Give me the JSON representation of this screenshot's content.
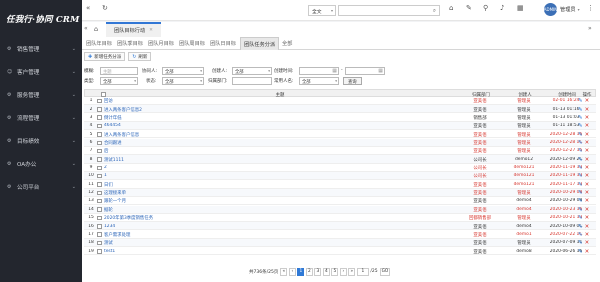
{
  "brand": {
    "logo_text": "任我行·协同 CRM"
  },
  "sidebar": {
    "items": [
      {
        "label": "销售管理",
        "icon": "gear-icon"
      },
      {
        "label": "客户管理",
        "icon": "user-icon"
      },
      {
        "label": "服务管理",
        "icon": "gear-icon"
      },
      {
        "label": "流程管理",
        "icon": "gear-icon"
      },
      {
        "label": "目标绩效",
        "icon": "gear-icon"
      },
      {
        "label": "OA办公",
        "icon": "gear-icon"
      },
      {
        "label": "公司平台",
        "icon": "gear-icon"
      }
    ]
  },
  "header": {
    "search_scope": "全文",
    "search_placeholder": "",
    "user_name": "管理员",
    "avatar_text": "ADMIN"
  },
  "page_tabs": [
    {
      "label": "团队目标行动"
    }
  ],
  "sub_tabs": [
    "团队年目标",
    "团队季目标",
    "团队月目标",
    "团队周目标",
    "团队日目标",
    "团队任务分派",
    "全部"
  ],
  "active_sub_tab": 5,
  "toolbar": {
    "new_label": "新增任务分派",
    "refresh_label": "刷新"
  },
  "filters": {
    "row1": {
      "theme_label": "模糊:",
      "theme_value": "主题",
      "assist_label": "协同人:",
      "assist_value": "全部",
      "creator_label": "创建人:",
      "creator_value": "全部",
      "ctime_label": "创建时间:",
      "ctime_to": "-"
    },
    "row2": {
      "type_label": "类型:",
      "type_value": "全部",
      "status_label": "状态:",
      "status_value": "全部",
      "dept_label": "归属部门:",
      "dept_value": "",
      "owner_label": "常用人名:",
      "owner_value": "全部",
      "query_label": "查询"
    }
  },
  "table": {
    "headers": {
      "title": "主题",
      "dept": "归属部门",
      "creator": "创建人",
      "time": "创建时间",
      "ops": "操作"
    },
    "rows": [
      {
        "no": "1",
        "title": "回访",
        "dept": "亚美佰",
        "creator": "管理员",
        "time": "02-01 16:24",
        "red": true
      },
      {
        "no": "2",
        "title": "进入两条客户信息2",
        "dept": "亚美佰",
        "creator": "管理员",
        "time": "01-13 01:16",
        "red": false
      },
      {
        "no": "3",
        "title": "倒计年低",
        "dept": "销售部",
        "creator": "管理员",
        "time": "01-13 01:03",
        "red": false
      },
      {
        "no": "4",
        "title": "464454",
        "dept": "亚美佰",
        "creator": "管理员",
        "time": "01-11 18:53",
        "red": false
      },
      {
        "no": "5",
        "title": "进入两条客户信息",
        "dept": "亚美佰",
        "creator": "管理员",
        "time": "2020-12-28 16",
        "red": true
      },
      {
        "no": "6",
        "title": "合同跟进",
        "dept": "亚美佰",
        "creator": "管理员",
        "time": "2020-12-28 1C",
        "red": true
      },
      {
        "no": "7",
        "title": "后",
        "dept": "亚美佰",
        "creator": "管理员",
        "time": "2020-12-27 15",
        "red": true
      },
      {
        "no": "8",
        "title": "测试1111",
        "dept": "公司长",
        "creator": "demo12",
        "time": "2020-12-09 2C",
        "red": false
      },
      {
        "no": "9",
        "title": "2",
        "dept": "公司长",
        "creator": "demo121",
        "time": "2020-11-19 13",
        "red": true
      },
      {
        "no": "10",
        "title": "1",
        "dept": "公司长",
        "creator": "demo121",
        "time": "2020-11-19 13",
        "red": true
      },
      {
        "no": "11",
        "title": "日们",
        "dept": "亚美佰",
        "creator": "demo121",
        "time": "2020-11-17 13",
        "red": true
      },
      {
        "no": "12",
        "title": "这理接来单",
        "dept": "亚美佰",
        "creator": "管理员",
        "time": "2020-10-29 08",
        "red": true
      },
      {
        "no": "13",
        "title": "跟轮一个月",
        "dept": "亚美佰",
        "creator": "demo4",
        "time": "2020-10-29 08",
        "red": false
      },
      {
        "no": "14",
        "title": "据轮",
        "dept": "亚美佰",
        "creator": "demo4",
        "time": "2020-10-23 16",
        "red": true
      },
      {
        "no": "15",
        "title": "2020年第3季度销售任务",
        "dept": "回都销售部",
        "creator": "管理员",
        "time": "2020-10-21 13",
        "red": true
      },
      {
        "no": "16",
        "title": "1234",
        "dept": "亚美佰",
        "creator": "demo4",
        "time": "2020-10-09 0C",
        "red": false
      },
      {
        "no": "17",
        "title": "客户需求处理",
        "dept": "亚美佰",
        "creator": "demo1",
        "time": "2020-07-22 1C",
        "red": true
      },
      {
        "no": "18",
        "title": "测试",
        "dept": "亚美佰",
        "creator": "管理员",
        "time": "2020-07-09 11",
        "red": false
      },
      {
        "no": "19",
        "title": "test1",
        "dept": "亚美佰",
        "creator": "demo8",
        "time": "2020-06-26 16",
        "red": false
      }
    ]
  },
  "pagination": {
    "summary": "共736条/25页",
    "first": "«",
    "prev": "‹",
    "pages": [
      "1",
      "2",
      "3",
      "4",
      "5"
    ],
    "current": "1",
    "next": "›",
    "last": "»",
    "jump_value": "1",
    "total": "/25",
    "go": "GO"
  }
}
